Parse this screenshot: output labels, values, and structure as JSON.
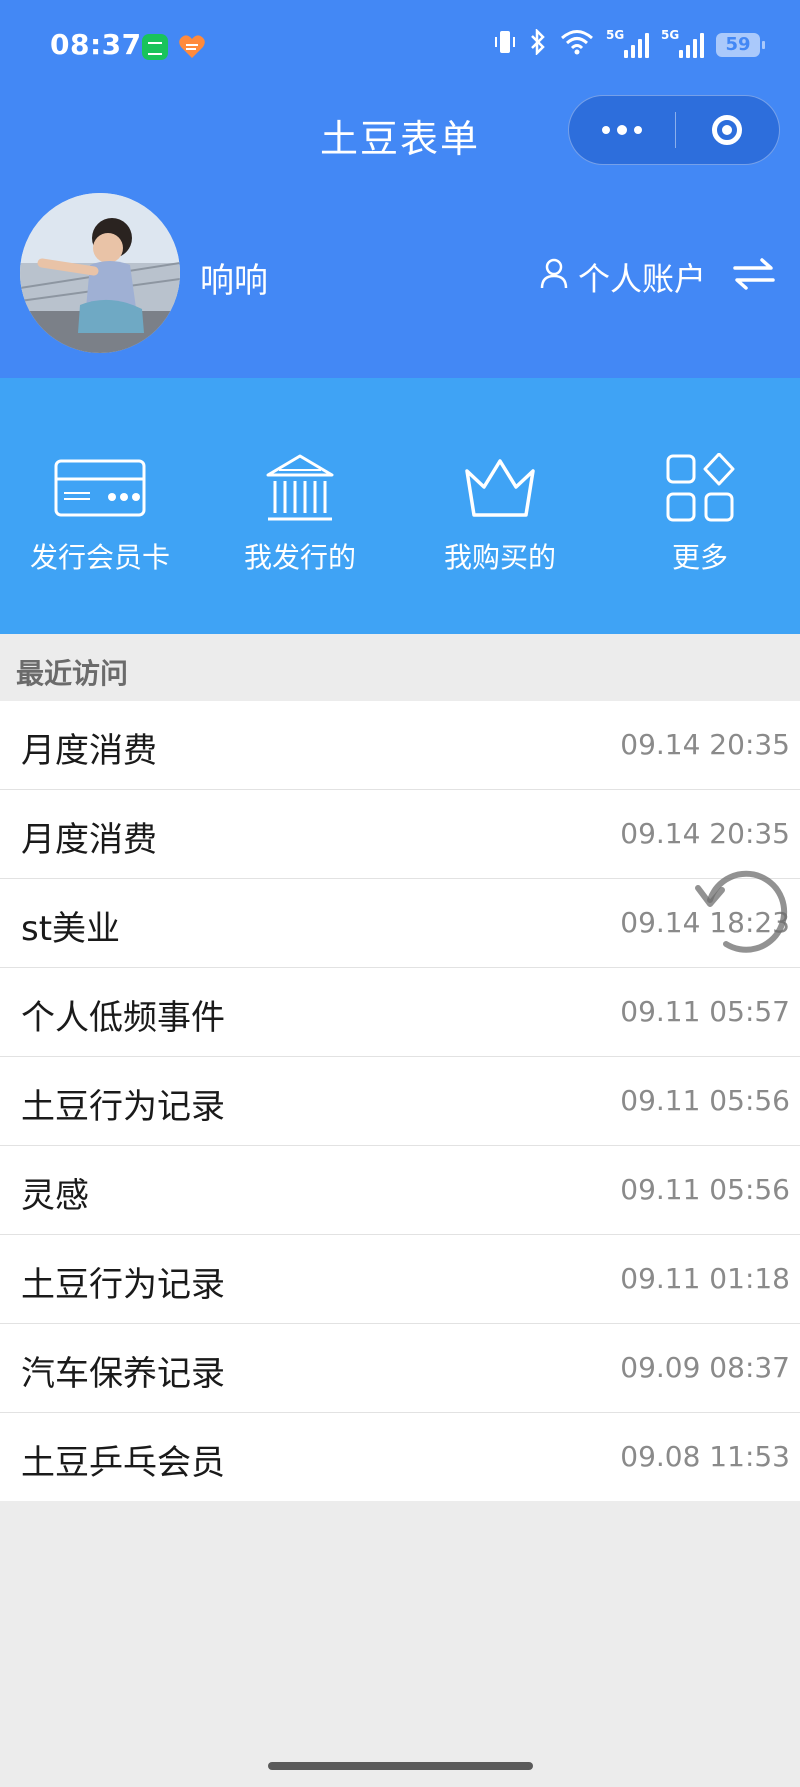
{
  "status_bar": {
    "time": "08:37",
    "battery": "59",
    "network": "5G"
  },
  "header": {
    "title": "土豆表单"
  },
  "profile": {
    "username": "响响",
    "account_label": "个人账户"
  },
  "menu": [
    {
      "label": "发行会员卡",
      "icon": "membership-card-icon"
    },
    {
      "label": "我发行的",
      "icon": "bank-icon"
    },
    {
      "label": "我购买的",
      "icon": "crown-icon"
    },
    {
      "label": "更多",
      "icon": "grid-more-icon"
    }
  ],
  "recent": {
    "heading": "最近访问",
    "items": [
      {
        "name": "月度消费",
        "time": "09.14 20:35"
      },
      {
        "name": "月度消费",
        "time": "09.14 20:35"
      },
      {
        "name": "st美业",
        "time": "09.14 18:23"
      },
      {
        "name": "个人低频事件",
        "time": "09.11 05:57"
      },
      {
        "name": "土豆行为记录",
        "time": "09.11 05:56"
      },
      {
        "name": "灵感",
        "time": "09.11 05:56"
      },
      {
        "name": "土豆行为记录",
        "time": "09.11 01:18"
      },
      {
        "name": "汽车保养记录",
        "time": "09.09 08:37"
      },
      {
        "name": "土豆乒乓会员",
        "time": "09.08 11:53"
      }
    ]
  },
  "colors": {
    "header_blue": "#4388f5",
    "menu_blue": "#3fa3f5",
    "page_bg": "#ececec"
  }
}
